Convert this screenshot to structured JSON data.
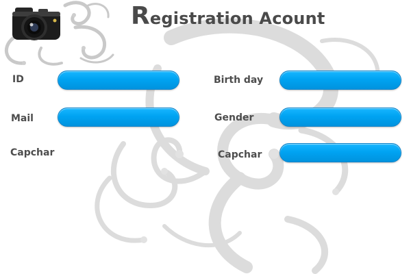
{
  "title": {
    "initial": "R",
    "rest": "egistration Acount"
  },
  "colors": {
    "field_fill": "#00a3f2",
    "field_border": "#0a82c9",
    "label_text": "#4d4d4d",
    "title_text": "#4a4a4a",
    "ornament": "#dcdcdc"
  },
  "logo": {
    "icon": "camera-icon"
  },
  "form": {
    "left": [
      {
        "label": "ID",
        "value": ""
      },
      {
        "label": "Mail",
        "value": ""
      },
      {
        "label": "Capchar"
      }
    ],
    "right": [
      {
        "label": "Birth day",
        "value": ""
      },
      {
        "label": "Gender",
        "value": ""
      },
      {
        "label": "Capchar",
        "value": ""
      }
    ]
  }
}
